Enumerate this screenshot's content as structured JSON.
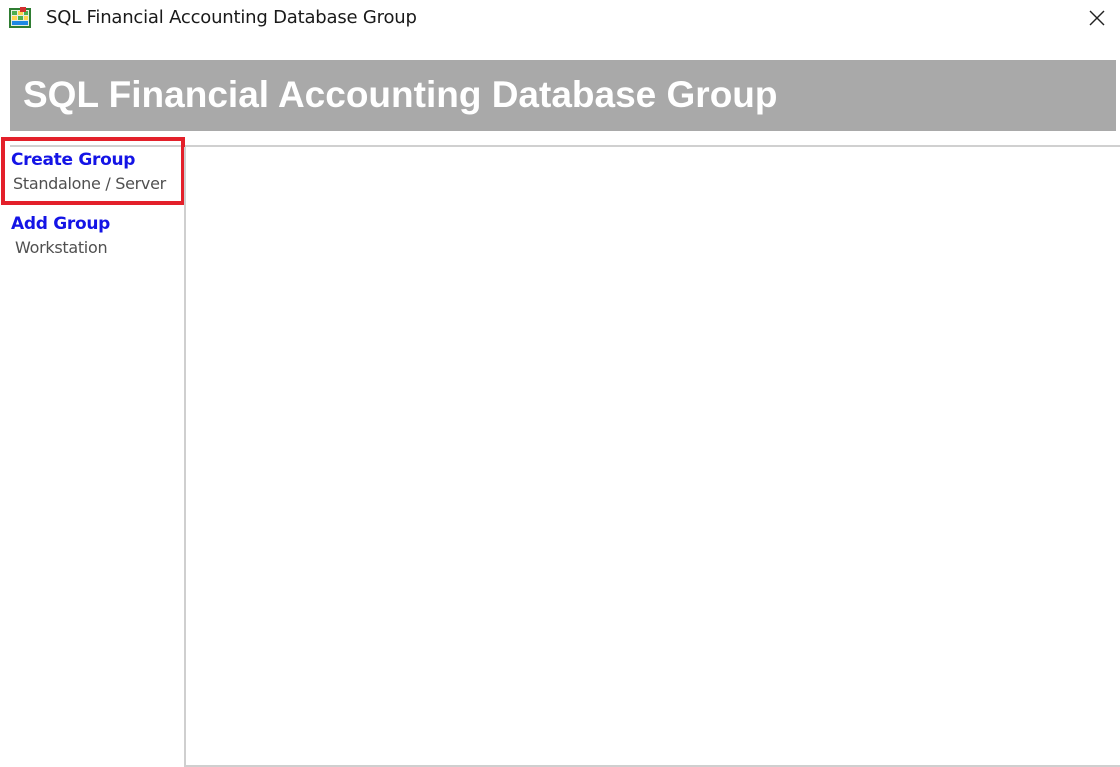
{
  "window": {
    "title": "SQL Financial Accounting Database Group",
    "icon": "database-group-app-icon",
    "close_icon": "close-icon"
  },
  "banner": {
    "title": "SQL Financial Accounting Database Group",
    "background": "#a9a9a9",
    "text_color": "#ffffff"
  },
  "sidebar": {
    "link_color": "#1414e6",
    "highlight_color": "#e3202a",
    "items": [
      {
        "label": "Create Group",
        "sublabel": "Standalone / Server",
        "highlighted": true
      },
      {
        "label": "Add Group",
        "sublabel": "Workstation",
        "highlighted": false
      }
    ]
  }
}
